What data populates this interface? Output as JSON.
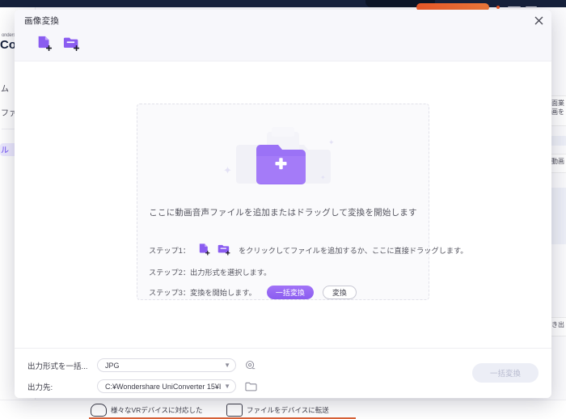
{
  "background": {
    "brand_small": "ondershare",
    "brand_large": "Co",
    "nav_items": [
      {
        "label": "ム",
        "name": "home"
      },
      {
        "label": "ファ",
        "name": "files"
      },
      {
        "label": "ル",
        "name": "tools",
        "active": true
      }
    ],
    "right_cards": [
      {
        "text": "面業\n画を"
      },
      {
        "text": "動画"
      },
      {
        "text": "き出"
      }
    ],
    "bottom_cards": [
      {
        "label": "様々なVRデバイスに対応した",
        "icon": "vr-headset-icon"
      },
      {
        "label": "ファイルをデバイスに転送",
        "icon": "device-transfer-icon"
      }
    ]
  },
  "dialog": {
    "title": "画像変換",
    "close_label": "×",
    "toolbar": {
      "add_file_label": "add-file",
      "add_folder_label": "add-folder"
    },
    "dropzone": {
      "caption": "ここに動画音声ファイルを追加またはドラッグして変換を開始します",
      "steps": [
        {
          "prefix": "ステップ1：",
          "suffix": "をクリックしてファイルを追加するか、ここに直接ドラッグします。",
          "has_icons": true
        },
        {
          "prefix": "ステップ2：出力形式を選択します。",
          "suffix": "",
          "has_icons": false
        },
        {
          "prefix": "ステップ3：変換を開始します。",
          "suffix": "",
          "has_icons": false,
          "buttons": [
            {
              "label": "一括変換",
              "style": "primary"
            },
            {
              "label": "変換",
              "style": "outline"
            }
          ]
        }
      ]
    },
    "footer": {
      "format_label": "出力形式を一括...",
      "format_value": "JPG",
      "format_settings_icon": "settings-gear-icon",
      "destination_label": "出力先:",
      "destination_value": "C:¥Wondershare UniConverter 15¥Im",
      "destination_browse_icon": "folder-open-icon",
      "convert_all_label": "一括変換"
    }
  },
  "colors": {
    "accent_purple": "#8a5cf0",
    "accent_purple_light": "#a273f7",
    "dark_navy": "#16213b",
    "orange": "#f05a28"
  }
}
